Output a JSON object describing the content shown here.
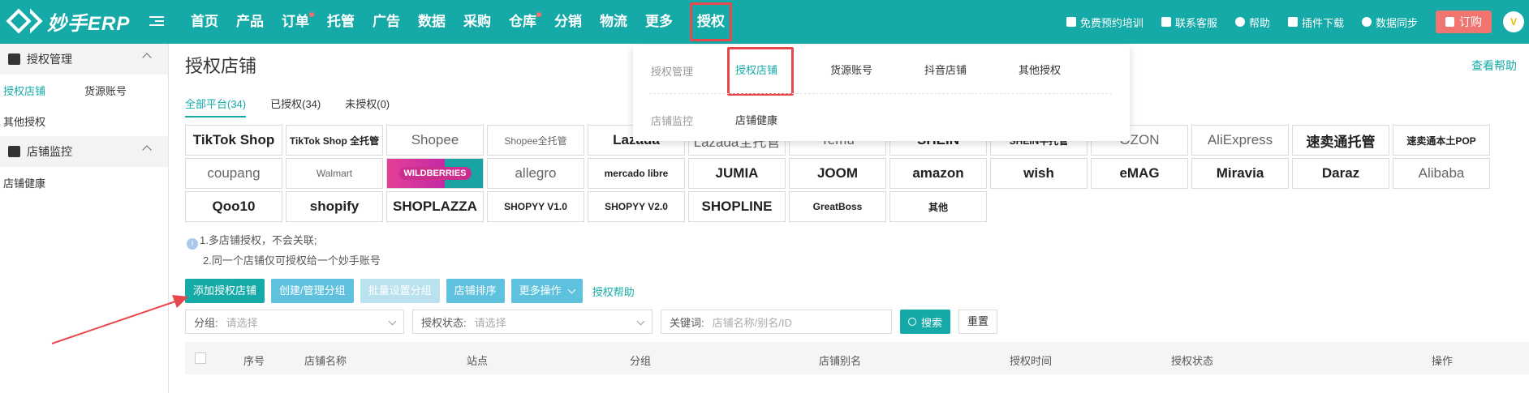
{
  "app": {
    "logo_text": "妙手ERP"
  },
  "nav": {
    "items": [
      {
        "label": "首页",
        "dot": false
      },
      {
        "label": "产品",
        "dot": false
      },
      {
        "label": "订单",
        "dot": true
      },
      {
        "label": "托管",
        "dot": false
      },
      {
        "label": "广告",
        "dot": false
      },
      {
        "label": "数据",
        "dot": false
      },
      {
        "label": "采购",
        "dot": false
      },
      {
        "label": "仓库",
        "dot": true
      },
      {
        "label": "分销",
        "dot": false
      },
      {
        "label": "物流",
        "dot": false
      },
      {
        "label": "更多",
        "dot": false
      }
    ],
    "active": "授权"
  },
  "tools": {
    "training": "免费预约培训",
    "support": "联系客服",
    "help": "帮助",
    "plugin": "插件下载",
    "sync": "数据同步",
    "order": "订购",
    "avatar": "V"
  },
  "sidebar": {
    "group1": "授权管理",
    "item_shops": "授权店铺",
    "item_sources": "货源账号",
    "item_other": "其他授权",
    "group2": "店铺监控",
    "item_health": "店铺健康"
  },
  "main": {
    "title": "授权店铺",
    "help_link": "查看帮助",
    "tabs": [
      "全部平台(34)",
      "已授权(34)",
      "未授权(0)"
    ],
    "platforms": [
      "TikTok Shop",
      "TikTok Shop 全托管",
      "Shopee",
      "Shopee全托管",
      "Lazada",
      "Lazada全托管",
      "Temu",
      "SHEIN",
      "SHEIN半托管",
      "OZON",
      "AliExpress",
      "速卖通托管",
      "速卖通本土POP",
      "coupang",
      "Walmart",
      "WILDBERRIES",
      "allegro",
      "mercado libre",
      "JUMIA",
      "JOOM",
      "amazon",
      "wish",
      "eMAG",
      "Miravia",
      "Daraz",
      "Alibaba",
      "Qoo10",
      "shopify",
      "SHOPLAZZA",
      "SHOPYY V1.0",
      "SHOPYY V2.0",
      "SHOPLINE",
      "GreatBoss",
      "其他"
    ],
    "notes": [
      "1.多店铺授权，不会关联;",
      "2.同一个店铺仅可授权给一个妙手账号"
    ],
    "buttons": {
      "add": "添加授权店铺",
      "groups": "创建/管理分组",
      "batch_group": "批量设置分组",
      "sort": "店铺排序",
      "more": "更多操作",
      "auth_help": "授权帮助"
    },
    "filters": {
      "group_label": "分组:",
      "group_placeholder": "请选择",
      "status_label": "授权状态:",
      "status_placeholder": "请选择",
      "keyword_label": "关键词:",
      "keyword_placeholder": "店铺名称/别名/ID",
      "search": "搜索",
      "reset": "重置"
    },
    "table_headers": [
      "序号",
      "店铺名称",
      "站点",
      "分组",
      "店铺别名",
      "授权时间",
      "授权状态",
      "操作"
    ]
  },
  "dropdown": {
    "group1": "授权管理",
    "items1": [
      "授权店铺",
      "货源账号",
      "抖音店铺",
      "其他授权"
    ],
    "group2": "店铺监控",
    "items2": [
      "店铺健康"
    ]
  }
}
